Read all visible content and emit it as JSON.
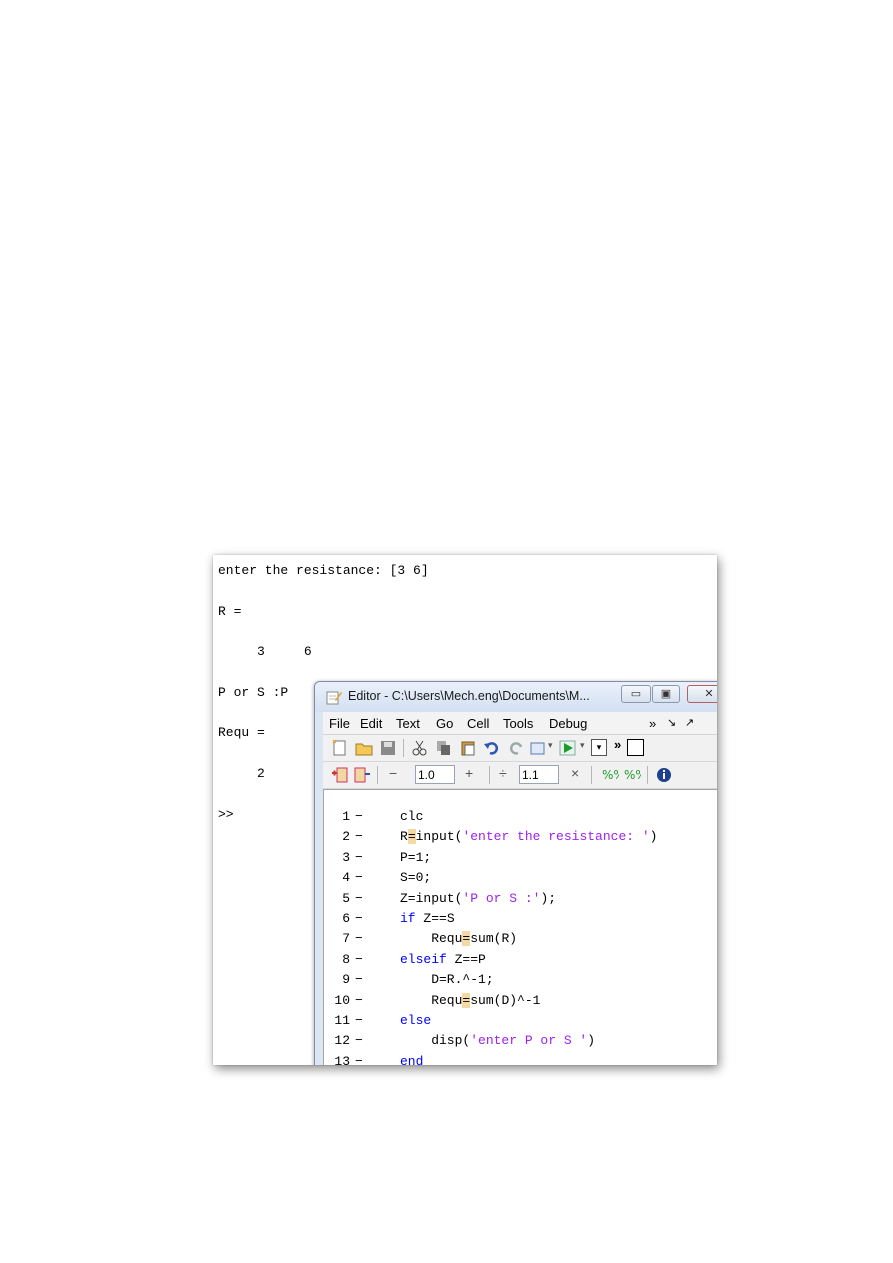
{
  "command_window": {
    "lines": [
      "enter the resistance: [3 6]",
      "R =",
      "     3     6",
      "P or S :P",
      "Requ =",
      "     2",
      ">>"
    ]
  },
  "editor": {
    "title": "Editor - C:\\Users\\Mech.eng\\Documents\\M...",
    "window_buttons": [
      "minimize",
      "restore",
      "close"
    ],
    "menu": [
      "File",
      "Edit",
      "Text",
      "Go",
      "Cell",
      "Tools",
      "Debug"
    ],
    "menu_overflow": "»",
    "toolbar2": {
      "field1": "1.0",
      "field2": "1.1",
      "minus": "−",
      "plus": "+",
      "divide": "÷",
      "times": "×"
    },
    "code_lines": [
      {
        "num": "1",
        "dash": "−",
        "text": "clc"
      },
      {
        "num": "2",
        "dash": "−",
        "text": "R=input('enter the resistance: ')"
      },
      {
        "num": "3",
        "dash": "−",
        "text": "P=1;"
      },
      {
        "num": "4",
        "dash": "−",
        "text": "S=0;"
      },
      {
        "num": "5",
        "dash": "−",
        "text": "Z=input('P or S :');"
      },
      {
        "num": "6",
        "dash": "−",
        "text": "if Z==S"
      },
      {
        "num": "7",
        "dash": "−",
        "text": "    Requ=sum(R)"
      },
      {
        "num": "8",
        "dash": "−",
        "text": "elseif Z==P"
      },
      {
        "num": "9",
        "dash": "−",
        "text": "    D=R.^-1;"
      },
      {
        "num": "10",
        "dash": "−",
        "text": "    Requ=sum(D)^-1"
      },
      {
        "num": "11",
        "dash": "−",
        "text": "else"
      },
      {
        "num": "12",
        "dash": "−",
        "text": "    disp('enter P or S ')"
      },
      {
        "num": "13",
        "dash": "−",
        "text": "end"
      }
    ]
  },
  "colors": {
    "keyword": "#0000ff",
    "string": "#a020f0",
    "highlight": "#f6d8a6"
  }
}
